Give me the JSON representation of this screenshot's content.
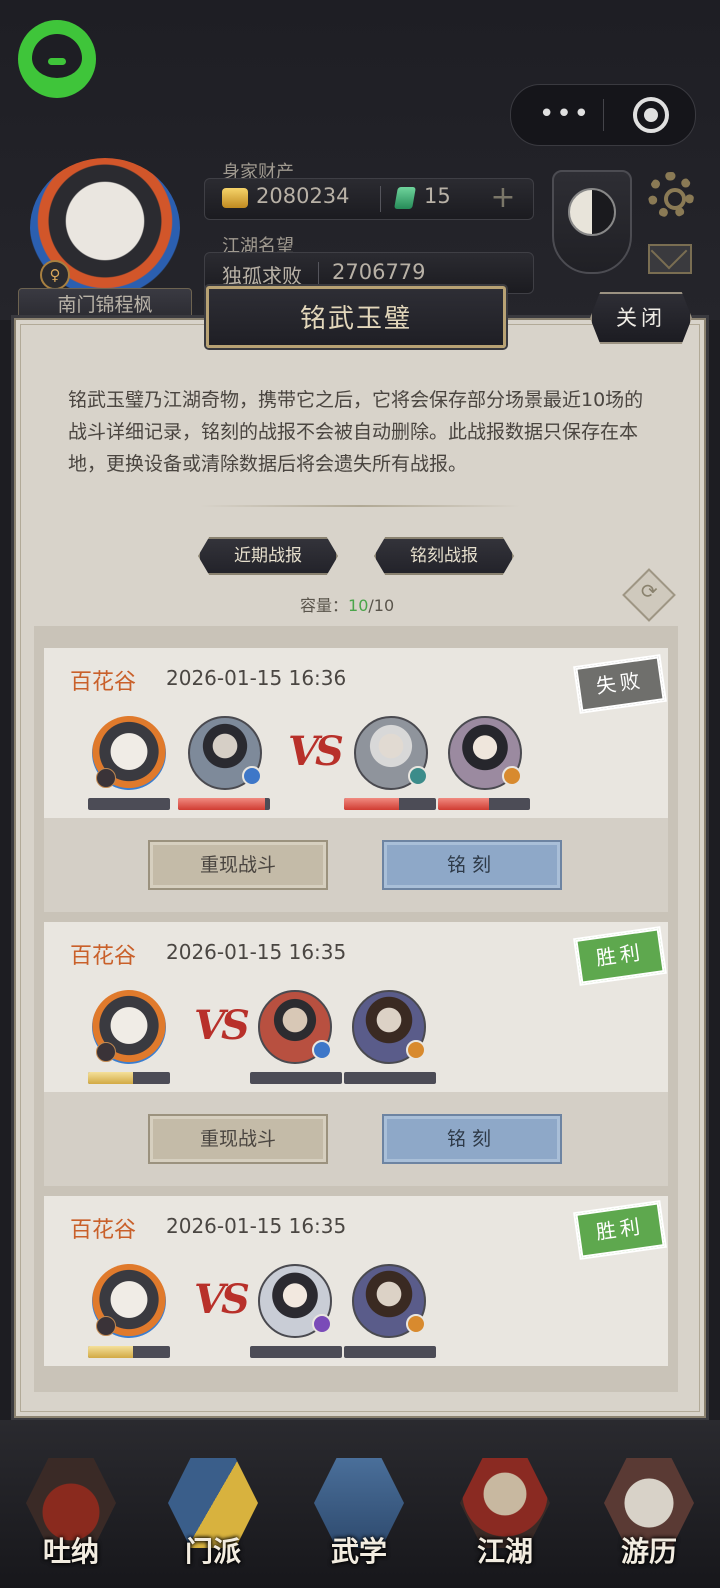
{
  "header": {
    "wealth_label": "身家财产",
    "gold": "2080234",
    "jade": "15",
    "plus": "+",
    "fame_label": "江湖名望",
    "fame_title": "独孤求败",
    "fame_value": "2706779",
    "player_name": "南门锦程枫",
    "gender_symbol": "♀",
    "capsule_more": "•••"
  },
  "dialog": {
    "title": "铭武玉璧",
    "close_label": "关闭",
    "description": "铭武玉璧乃江湖奇物，携带它之后，它将会保存部分场景最近10场的战斗详细记录，铭刻的战报不会被自动删除。此战报数据只保存在本地，更换设备或清除数据后将会遗失所有战报。",
    "tabs": [
      "近期战报",
      "铭刻战报"
    ],
    "capacity_label": "容量：",
    "capacity_used": "10",
    "capacity_total": "/10"
  },
  "battles": [
    {
      "location": "百花谷",
      "time": "2026-01-15 16:36",
      "result": "失败",
      "vs": "VS",
      "replay_label": "重现战斗",
      "engrave_label": "铭刻",
      "team_hp": [
        0.0,
        0.95
      ],
      "enemy_hp": [
        0.6,
        0.55
      ]
    },
    {
      "location": "百花谷",
      "time": "2026-01-15 16:35",
      "result": "胜利",
      "vs": "VS",
      "replay_label": "重现战斗",
      "engrave_label": "铭刻",
      "team_hp": [
        0.55
      ],
      "enemy_hp": [
        0.0,
        0.0
      ]
    },
    {
      "location": "百花谷",
      "time": "2026-01-15 16:35",
      "result": "胜利",
      "vs": "VS",
      "team_hp": [
        0.55
      ],
      "enemy_hp": [
        0.0,
        0.0
      ]
    }
  ],
  "nav": [
    {
      "label": "吐纳",
      "icon": "meditation-icon"
    },
    {
      "label": "门派",
      "icon": "sect-icon"
    },
    {
      "label": "武学",
      "icon": "martial-arts-book-icon"
    },
    {
      "label": "江湖",
      "icon": "jianghu-icon"
    },
    {
      "label": "游历",
      "icon": "travel-horse-icon"
    }
  ],
  "colors": {
    "win": "#5ea84e",
    "lose": "#6f6f6c",
    "location": "#c9602a",
    "hp_red": "#d03c32",
    "hp_gold": "#d2aa44"
  }
}
